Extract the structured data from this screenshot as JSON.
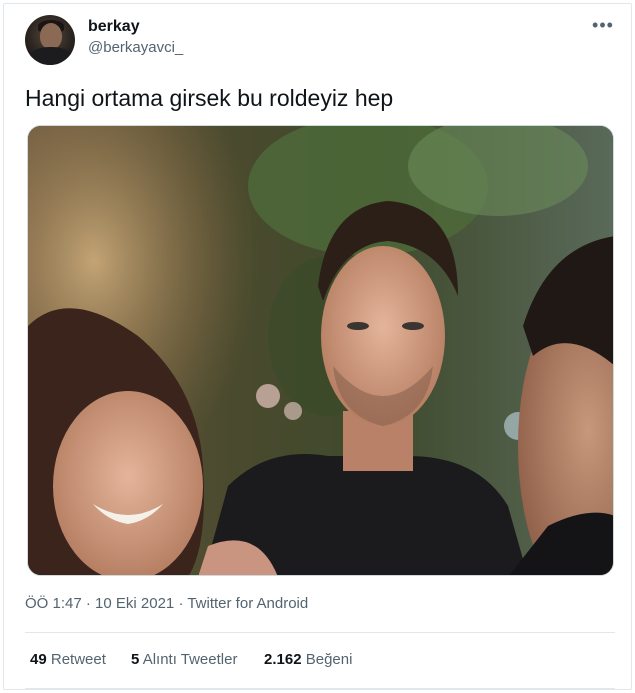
{
  "colors": {
    "text_primary": "#0f1419",
    "text_secondary": "#536471",
    "border": "#e1e8ed"
  },
  "user": {
    "display_name": "berkay",
    "handle": "@berkayavci_"
  },
  "more_icon": "more-horizontal-icon",
  "tweet": {
    "text": "Hangi ortama girsek bu roldeyiz hep"
  },
  "meta": {
    "time": "ÖÖ 1:47",
    "sep1": " · ",
    "date": "10 Eki 2021",
    "sep2": " · ",
    "source": "Twitter for Android"
  },
  "stats": {
    "retweets": {
      "count": "49",
      "label": "Retweet"
    },
    "quotes": {
      "count": "5",
      "label": "Alıntı Tweetler"
    },
    "likes": {
      "count": "2.162",
      "label": "Beğeni"
    }
  }
}
